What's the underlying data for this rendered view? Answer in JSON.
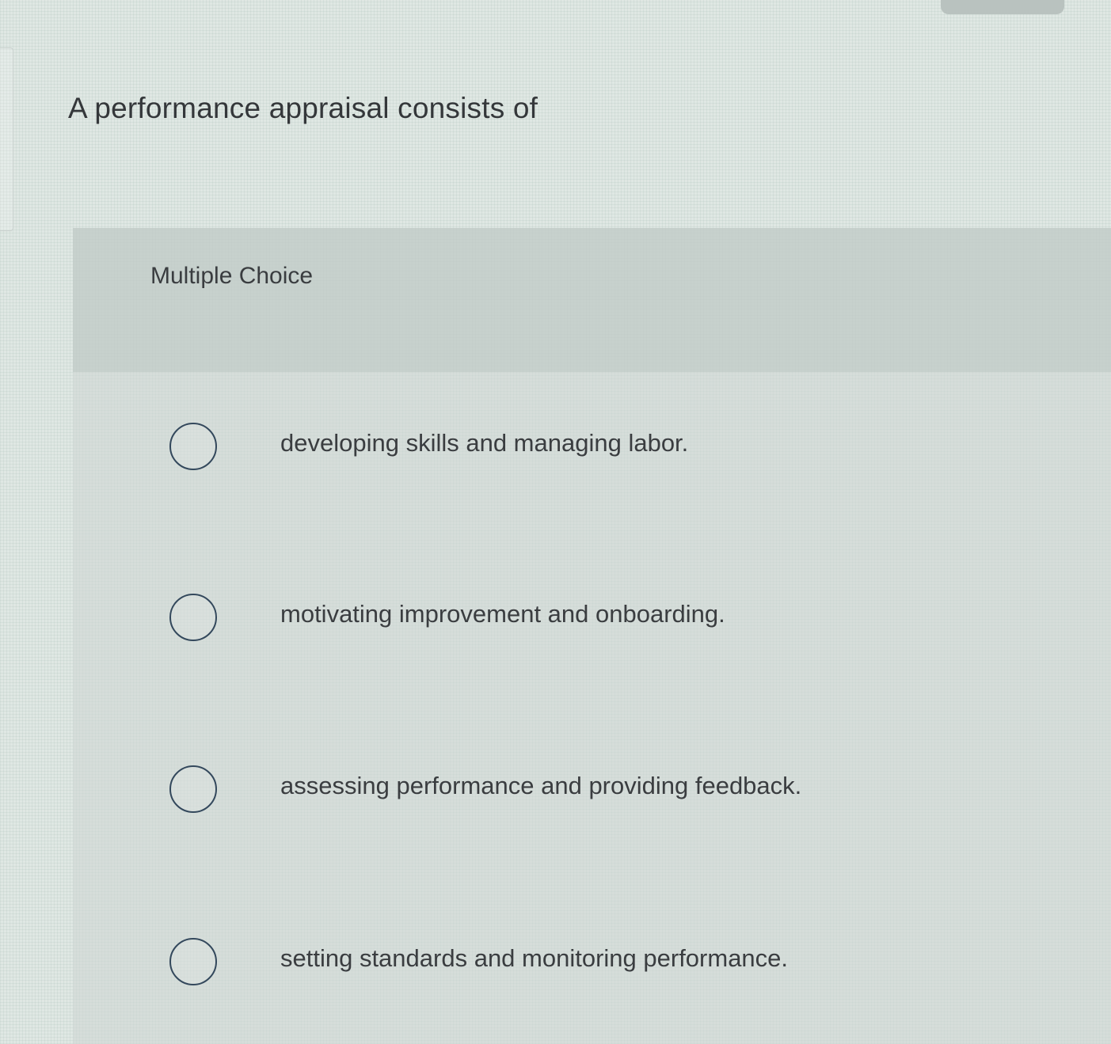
{
  "question": {
    "text": "A performance appraisal consists of"
  },
  "choice_panel": {
    "type_label": "Multiple Choice"
  },
  "options": [
    {
      "label": "developing skills and managing labor.",
      "selected": false
    },
    {
      "label": "motivating improvement and onboarding.",
      "selected": false
    },
    {
      "label": "assessing performance and providing feedback.",
      "selected": false
    },
    {
      "label": "setting standards and monitoring performance.",
      "selected": false
    }
  ]
}
